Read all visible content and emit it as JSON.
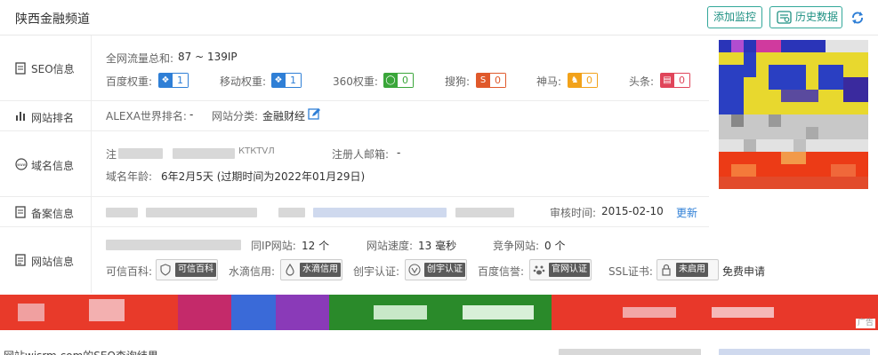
{
  "header": {
    "title": "陕西金融频道",
    "add_monitor": "添加监控",
    "history": "历史数据"
  },
  "seo": {
    "label": "SEO信息",
    "traffic_label": "全网流量总和:",
    "traffic_value": "87 ~ 139IP",
    "weights": [
      {
        "label": "百度权重:",
        "value": "1",
        "color": "#2f7fd6"
      },
      {
        "label": "移动权重:",
        "value": "1",
        "color": "#2f7fd6"
      },
      {
        "label": "360权重:",
        "value": "0",
        "color": "#3aa63a"
      },
      {
        "label": "搜狗:",
        "value": "0",
        "color": "#e0592b"
      },
      {
        "label": "神马:",
        "value": "0",
        "color": "#f2a21a"
      },
      {
        "label": "头条:",
        "value": "0",
        "color": "#e0455a"
      }
    ]
  },
  "rank": {
    "label": "网站排名",
    "alexa_label": "ALEXA世界排名:",
    "alexa_value": "-",
    "category_label": "网站分类:",
    "category_value": "金融财经"
  },
  "domain": {
    "label": "域名信息",
    "registrant_partial": "注",
    "registrant_tail": "КТКТVЛ",
    "email_label": "注册人邮箱:",
    "email_value": "-",
    "age_label": "域名年龄:",
    "age_value": "6年2月5天 (过期时间为2022年01月29日)"
  },
  "icp": {
    "label": "备案信息",
    "review_label": "审核时间:",
    "review_value": "2015-02-10",
    "update": "更新"
  },
  "site": {
    "label": "网站信息",
    "same_ip_label": "同IP网站:",
    "same_ip_value": "12 个",
    "speed_label": "网站速度:",
    "speed_value": "13 毫秒",
    "competitor_label": "竞争网站:",
    "competitor_value": "0 个",
    "certs": [
      {
        "label": "可信百科:",
        "badge": "可信百科"
      },
      {
        "label": "水滴信用:",
        "badge": "水滴信用"
      },
      {
        "label": "创宇认证:",
        "badge": "创宇认证"
      },
      {
        "label": "百度信誉:",
        "badge": "官网认证"
      },
      {
        "label": "SSL证书:",
        "badge": "未启用"
      }
    ],
    "free_apply": "免费申请"
  },
  "ad": {
    "tag": "广告"
  },
  "footer": {
    "text": "网站wjsrm.com的SEO查询结果"
  }
}
